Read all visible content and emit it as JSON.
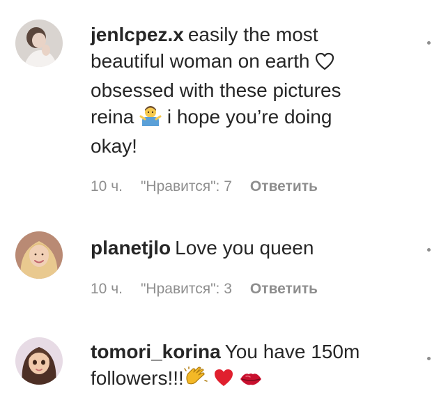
{
  "comments": [
    {
      "username": "jenlcpez.x",
      "text_lines": [
        "easily the most",
        "beautiful woman on earth",
        "obsessed with these pictures",
        "reina",
        "i hope you’re doing",
        "okay!"
      ],
      "time": "10 ч.",
      "likes": "\"Нравится\": 7",
      "reply": "Ответить",
      "icons": [
        "white-heart-emoji-icon",
        "person-gesturing-emoji-icon"
      ]
    },
    {
      "username": "planetjlo",
      "text": "Love you queen",
      "time": "10 ч.",
      "likes": "\"Нравится\": 3",
      "reply": "Ответить"
    },
    {
      "username": "tomori_korina",
      "text_line1": "You have 150m",
      "text_line2": "followers!!!",
      "icons": [
        "clapping-hands-emoji-icon",
        "red-heart-emoji-icon",
        "kiss-lips-emoji-icon"
      ]
    }
  ],
  "colors": {
    "text": "#262626",
    "meta": "#8e8e8e",
    "heart_red": "#e0202e"
  }
}
